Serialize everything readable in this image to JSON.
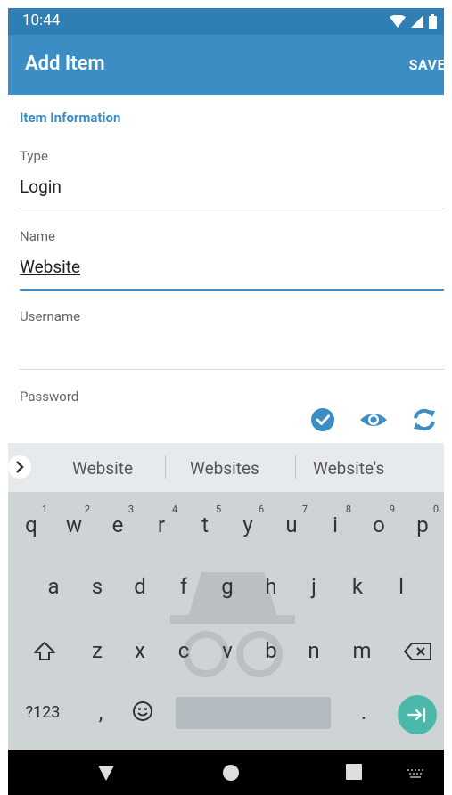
{
  "status": {
    "time": "10:44"
  },
  "header": {
    "title": "Add Item",
    "save_label": "SAVE"
  },
  "form": {
    "section_title": "Item Information",
    "type_label": "Type",
    "type_value": "Login",
    "name_label": "Name",
    "name_value": "Website",
    "username_label": "Username",
    "password_label": "Password"
  },
  "keyboard": {
    "suggestions": [
      "Website",
      "Websites",
      "Website's"
    ],
    "row1": [
      "q",
      "w",
      "e",
      "r",
      "t",
      "y",
      "u",
      "i",
      "o",
      "p"
    ],
    "row1_hints": [
      "1",
      "2",
      "3",
      "4",
      "5",
      "6",
      "7",
      "8",
      "9",
      "0"
    ],
    "row2": [
      "a",
      "s",
      "d",
      "f",
      "g",
      "h",
      "j",
      "k",
      "l"
    ],
    "row3": [
      "z",
      "x",
      "c",
      "v",
      "b",
      "n",
      "m"
    ],
    "symbols_label": "?123",
    "comma_label": ",",
    "period_label": "."
  },
  "colors": {
    "accent": "#3c8dc4",
    "status": "#2f7fb5",
    "enter": "#4bb8a9"
  }
}
